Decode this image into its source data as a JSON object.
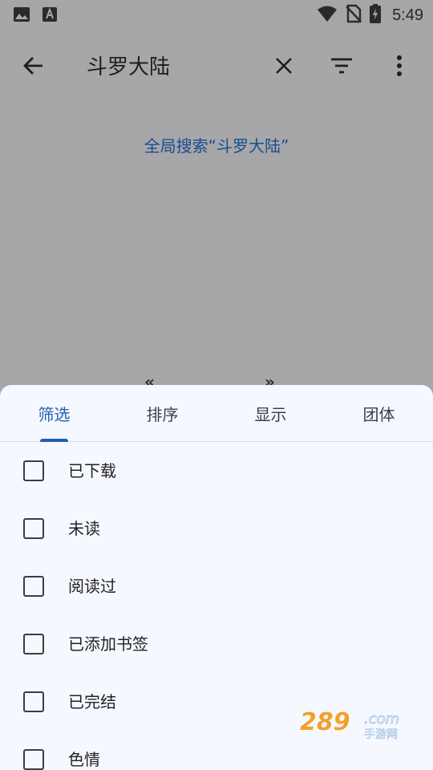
{
  "status_bar": {
    "time": "5:49",
    "icons": [
      "image-icon",
      "font-a-icon",
      "wifi-icon",
      "no-sim-icon",
      "battery-charging-icon"
    ]
  },
  "toolbar": {
    "search_query": "斗罗大陆",
    "icons": [
      "back-arrow-icon",
      "close-icon",
      "filter-icon",
      "more-vert-icon"
    ]
  },
  "content": {
    "global_search_label": "全局搜索“斗罗大陆”"
  },
  "sheet": {
    "tabs": [
      {
        "label": "筛选",
        "active": true
      },
      {
        "label": "排序",
        "active": false
      },
      {
        "label": "显示",
        "active": false
      },
      {
        "label": "团体",
        "active": false
      }
    ],
    "options": [
      {
        "label": "已下载",
        "checked": false
      },
      {
        "label": "未读",
        "checked": false
      },
      {
        "label": "阅读过",
        "checked": false
      },
      {
        "label": "已添加书签",
        "checked": false
      },
      {
        "label": "已完结",
        "checked": false
      },
      {
        "label": "色情",
        "checked": false
      }
    ]
  },
  "watermark": {
    "text": "289.com",
    "subtext": "手游网"
  },
  "colors": {
    "scrim": "#a7a6a8",
    "sheet_bg": "#f6f8ff",
    "accent": "#1f5fb6",
    "link": "#1a4d93",
    "text": "#222226"
  }
}
